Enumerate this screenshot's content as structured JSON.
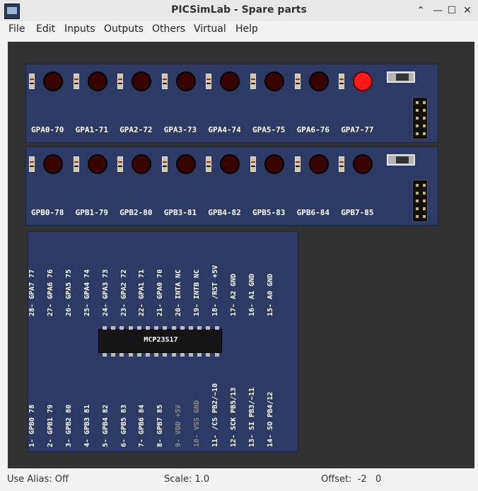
{
  "window": {
    "title": "PICSimLab - Spare parts"
  },
  "menu": [
    "File",
    "Edit",
    "Inputs",
    "Outputs",
    "Others",
    "Virtual",
    "Help"
  ],
  "leds_a": [
    {
      "label": "GPA0-70",
      "on": false
    },
    {
      "label": "GPA1-71",
      "on": false
    },
    {
      "label": "GPA2-72",
      "on": false
    },
    {
      "label": "GPA3-73",
      "on": false
    },
    {
      "label": "GPA4-74",
      "on": false
    },
    {
      "label": "GPA5-75",
      "on": false
    },
    {
      "label": "GPA6-76",
      "on": false
    },
    {
      "label": "GPA7-77",
      "on": true
    }
  ],
  "leds_b": [
    {
      "label": "GPB0-78",
      "on": false
    },
    {
      "label": "GPB1-79",
      "on": false
    },
    {
      "label": "GPB2-80",
      "on": false
    },
    {
      "label": "GPB3-81",
      "on": false
    },
    {
      "label": "GPB4-82",
      "on": false
    },
    {
      "label": "GPB5-83",
      "on": false
    },
    {
      "label": "GPB6-84",
      "on": false
    },
    {
      "label": "GPB7-85",
      "on": false
    }
  ],
  "chip": {
    "name": "MCP23S17",
    "top_pins": [
      {
        "label": "28- GPA7 77",
        "dim": false
      },
      {
        "label": "27- GPA6 76",
        "dim": false
      },
      {
        "label": "26- GPA5 75",
        "dim": false
      },
      {
        "label": "25- GPA4 74",
        "dim": false
      },
      {
        "label": "24- GPA3 73",
        "dim": false
      },
      {
        "label": "23- GPA2 72",
        "dim": false
      },
      {
        "label": "22- GPA1 71",
        "dim": false
      },
      {
        "label": "21- GPA0 70",
        "dim": false
      },
      {
        "label": "20- INTA NC",
        "dim": false
      },
      {
        "label": "19- INTB NC",
        "dim": false
      },
      {
        "label": "18- /RST +5V",
        "dim": false
      },
      {
        "label": "17- A2 GND",
        "dim": false
      },
      {
        "label": "16- A1 GND",
        "dim": false
      },
      {
        "label": "15- A0 GND",
        "dim": false
      }
    ],
    "bottom_pins": [
      {
        "label": "1- GPB0 78",
        "dim": false
      },
      {
        "label": "2- GPB1 79",
        "dim": false
      },
      {
        "label": "3- GPB2 80",
        "dim": false
      },
      {
        "label": "4- GPB3 81",
        "dim": false
      },
      {
        "label": "5- GPB4 82",
        "dim": false
      },
      {
        "label": "6- GPB5 83",
        "dim": false
      },
      {
        "label": "7- GPB6 84",
        "dim": false
      },
      {
        "label": "8- GPB7 85",
        "dim": false
      },
      {
        "label": "9- VDD +5V",
        "dim": true
      },
      {
        "label": "10- VSS GND",
        "dim": true
      },
      {
        "label": "11- /CS PB2/~10",
        "dim": false
      },
      {
        "label": "12- SCK PB5/13",
        "dim": false
      },
      {
        "label": "13- SI PB3/~11",
        "dim": false
      },
      {
        "label": "14- SO PB4/12",
        "dim": false
      }
    ]
  },
  "status": {
    "alias": "Use Alias: Off",
    "scale": "Scale: 1.0",
    "offset": "Offset:  -2   0"
  },
  "colors": {
    "board": "#2d3a66",
    "canvas": "#323232",
    "led_on": "#ff1a1a",
    "led_off": "#3a0303"
  }
}
